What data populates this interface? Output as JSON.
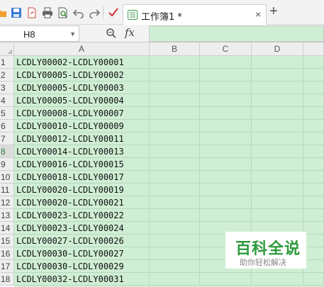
{
  "toolbar": {
    "icons": [
      "folder-icon",
      "save-icon",
      "pdf-icon",
      "print-icon",
      "print-preview-icon",
      "undo-icon",
      "redo-icon",
      "format-painter-icon"
    ]
  },
  "document_tab": {
    "title": "工作簿1 *",
    "close": "×",
    "new_tab": "+"
  },
  "formula_bar": {
    "cell_ref": "H8",
    "fx_label": "fx",
    "content": ""
  },
  "sheet": {
    "columns": [
      "A",
      "B",
      "C",
      "D"
    ],
    "active_row": "8",
    "rows": [
      {
        "num": "1",
        "a": "LCDLY00002-LCDLY00001"
      },
      {
        "num": "2",
        "a": "LCDLY00005-LCDLY00002"
      },
      {
        "num": "3",
        "a": "LCDLY00005-LCDLY00003"
      },
      {
        "num": "4",
        "a": "LCDLY00005-LCDLY00004"
      },
      {
        "num": "5",
        "a": "LCDLY00008-LCDLY00007"
      },
      {
        "num": "6",
        "a": "LCDLY00010-LCDLY00009"
      },
      {
        "num": "7",
        "a": "LCDLY00012-LCDLY00011"
      },
      {
        "num": "8",
        "a": "LCDLY00014-LCDLY00013"
      },
      {
        "num": "9",
        "a": "LCDLY00016-LCDLY00015"
      },
      {
        "num": "10",
        "a": "LCDLY00018-LCDLY00017"
      },
      {
        "num": "11",
        "a": "LCDLY00020-LCDLY00019"
      },
      {
        "num": "12",
        "a": "LCDLY00020-LCDLY00021"
      },
      {
        "num": "13",
        "a": "LCDLY00023-LCDLY00022"
      },
      {
        "num": "14",
        "a": "LCDLY00023-LCDLY00024"
      },
      {
        "num": "15",
        "a": "LCDLY00027-LCDLY00026"
      },
      {
        "num": "16",
        "a": "LCDLY00030-LCDLY00027"
      },
      {
        "num": "17",
        "a": "LCDLY00030-LCDLY00029"
      },
      {
        "num": "18",
        "a": "LCDLY00032-LCDLY00031"
      }
    ]
  },
  "watermark": {
    "title": "百科全说",
    "subtitle": "助你轻松解决"
  },
  "colors": {
    "cell_fill": "#cfeed4",
    "accent_green": "#2b9b3b",
    "header_gray": "#eeeeee"
  }
}
